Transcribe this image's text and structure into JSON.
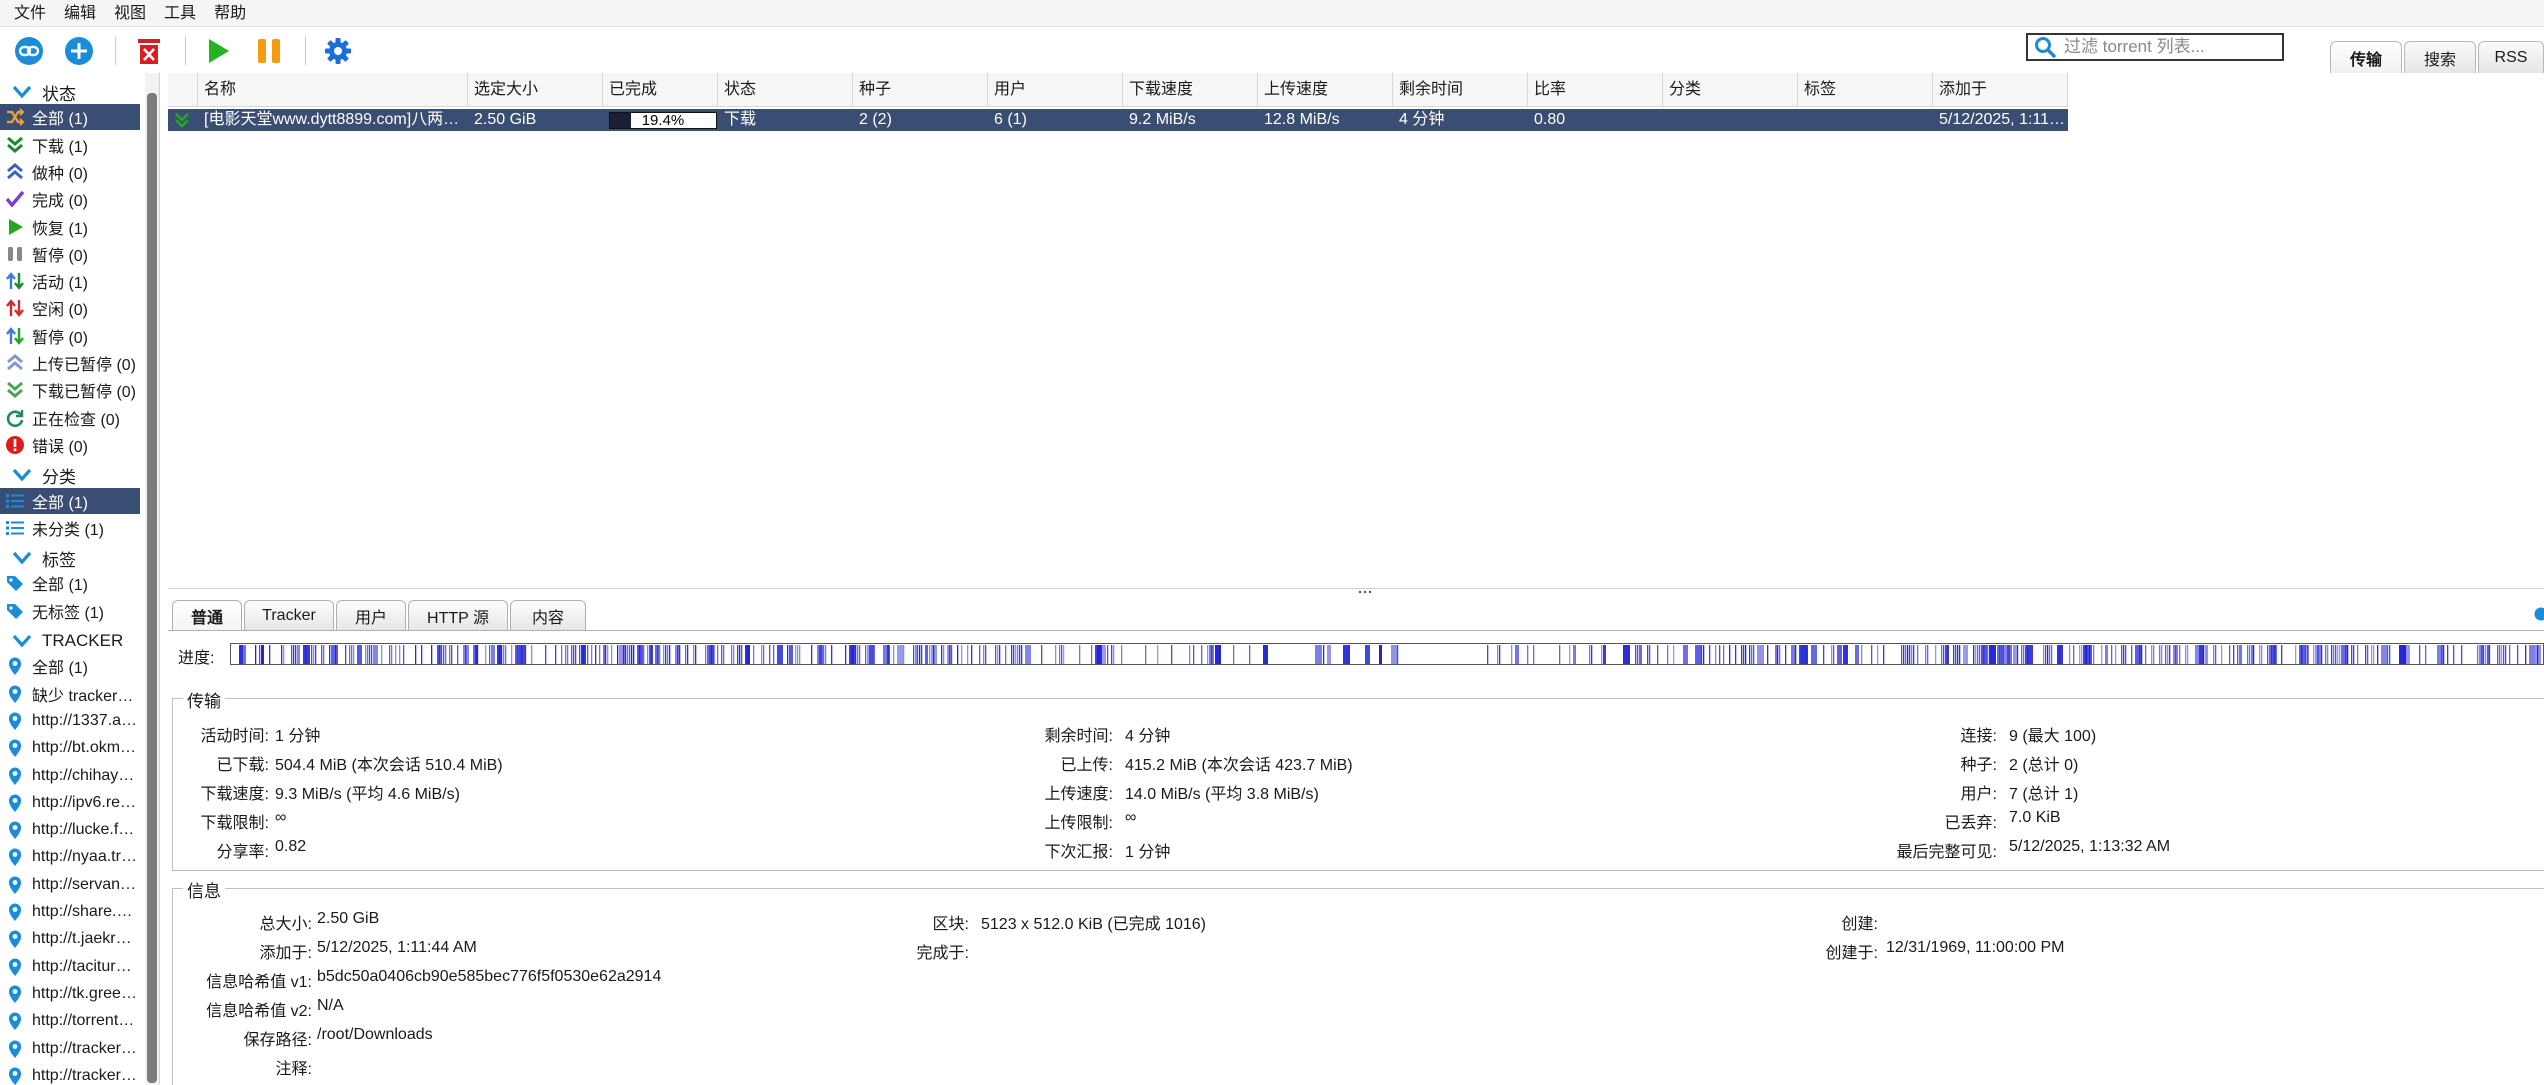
{
  "menu": [
    "文件",
    "编辑",
    "视图",
    "工具",
    "帮助"
  ],
  "toolbar": {
    "filter_placeholder": "过滤 torrent 列表...",
    "right_tabs": [
      "传输",
      "搜索",
      "RSS"
    ]
  },
  "sidebar": {
    "status_header": "状态",
    "status_items": [
      {
        "label": "全部 (1)",
        "icon": "shuffle-icon",
        "color": "#e8a33a"
      },
      {
        "label": "下载 (1)",
        "icon": "double-chevron-down-icon",
        "color": "#1e8a2a"
      },
      {
        "label": "做种 (0)",
        "icon": "double-chevron-up-icon",
        "color": "#3b63c4"
      },
      {
        "label": "完成 (0)",
        "icon": "checkmark-icon",
        "color": "#7a3ec8"
      },
      {
        "label": "恢复 (1)",
        "icon": "play-icon",
        "color": "#22a822"
      },
      {
        "label": "暂停 (0)",
        "icon": "pause-icon",
        "color": "#888888"
      },
      {
        "label": "活动 (1)",
        "icon": "up-down-arrows-icon",
        "color": "#1e8a2a"
      },
      {
        "label": "空闲 (0)",
        "icon": "up-down-arrows-red-icon",
        "color": "#d22a2a"
      },
      {
        "label": "暂停 (0)",
        "icon": "up-down-arrows-paused-icon",
        "color": "#3b7ad6"
      },
      {
        "label": "上传已暂停 (0)",
        "icon": "chevron-up-paused-icon",
        "color": "#7f9ad8"
      },
      {
        "label": "下载已暂停 (0)",
        "icon": "chevron-down-paused-icon",
        "color": "#4aa35a"
      },
      {
        "label": "正在检查 (0)",
        "icon": "refresh-icon",
        "color": "#1f8a6a"
      },
      {
        "label": "错误 (0)",
        "icon": "error-icon",
        "color": "#e01b1b"
      }
    ],
    "category_header": "分类",
    "category_items": [
      {
        "label": "全部 (1)",
        "icon": "list-icon"
      },
      {
        "label": "未分类 (1)",
        "icon": "list-icon"
      }
    ],
    "tag_header": "标签",
    "tag_items": [
      {
        "label": "全部 (1)",
        "icon": "tag-icon"
      },
      {
        "label": "无标签 (1)",
        "icon": "tag-icon"
      }
    ],
    "tracker_header": "TRACKER",
    "tracker_items": [
      "全部 (1)",
      "缺少 tracker…",
      "http://1337.a…",
      "http://bt.okm…",
      "http://chihay…",
      "http://ipv6.re…",
      "http://lucke.f…",
      "http://nyaa.tr…",
      "http://servan…",
      "http://share.…",
      "http://t.jaekr…",
      "http://tacitur…",
      "http://tk.gree…",
      "http://torrent…",
      "http://tracker…",
      "http://tracker…"
    ]
  },
  "table": {
    "columns": [
      "名称",
      "选定大小",
      "已完成",
      "状态",
      "种子",
      "用户",
      "下载速度",
      "上传速度",
      "剩余时间",
      "比率",
      "分类",
      "标签",
      "添加于"
    ],
    "row": {
      "name": "[电影天堂www.dytt8899.com]八两…",
      "size": "2.50 GiB",
      "progress_text": "19.4%",
      "progress": 0.194,
      "status": "下载",
      "seeds": "2 (2)",
      "peers": "6 (1)",
      "down_speed": "9.2 MiB/s",
      "up_speed": "12.8 MiB/s",
      "eta": "4 分钟",
      "ratio": "0.80",
      "category": "",
      "tags": "",
      "added": "5/12/2025, 1:11…"
    }
  },
  "details": {
    "tabs": [
      "普通",
      "Tracker",
      "用户",
      "HTTP 源",
      "内容"
    ],
    "progress_label": "进度:",
    "transfer_title": "传输",
    "transfer": {
      "col1": [
        {
          "label": "活动时间:",
          "value": "1 分钟"
        },
        {
          "label": "已下载:",
          "value": "504.4 MiB (本次会话 510.4 MiB)"
        },
        {
          "label": "下载速度:",
          "value": "9.3 MiB/s (平均 4.6 MiB/s)"
        },
        {
          "label": "下载限制:",
          "value": "∞"
        },
        {
          "label": "分享率:",
          "value": "0.82"
        }
      ],
      "col2": [
        {
          "label": "剩余时间:",
          "value": "4 分钟"
        },
        {
          "label": "已上传:",
          "value": "415.2 MiB (本次会话 423.7 MiB)"
        },
        {
          "label": "上传速度:",
          "value": "14.0 MiB/s (平均 3.8 MiB/s)"
        },
        {
          "label": "上传限制:",
          "value": "∞"
        },
        {
          "label": "下次汇报:",
          "value": "1 分钟"
        }
      ],
      "col3": [
        {
          "label": "连接:",
          "value": "9 (最大 100)"
        },
        {
          "label": "种子:",
          "value": "2 (总计 0)"
        },
        {
          "label": "用户:",
          "value": "7 (总计 1)"
        },
        {
          "label": "已丢弃:",
          "value": "7.0 KiB"
        },
        {
          "label": "最后完整可见:",
          "value": "5/12/2025, 1:13:32 AM"
        }
      ]
    },
    "info_title": "信息",
    "info": {
      "col1": [
        {
          "label": "总大小:",
          "value": "2.50 GiB"
        },
        {
          "label": "添加于:",
          "value": "5/12/2025, 1:11:44 AM"
        },
        {
          "label": "信息哈希值 v1:",
          "value": "b5dc50a0406cb90e585bec776f5f0530e62a2914"
        },
        {
          "label": "信息哈希值 v2:",
          "value": "N/A"
        },
        {
          "label": "保存路径:",
          "value": "/root/Downloads"
        },
        {
          "label": "注释:",
          "value": ""
        }
      ],
      "col2": [
        {
          "label": "区块:",
          "value": "5123 x 512.0 KiB (已完成 1016)"
        },
        {
          "label": "完成于:",
          "value": ""
        }
      ],
      "col3": [
        {
          "label": "创建:",
          "value": ""
        },
        {
          "label": "创建于:",
          "value": "12/31/1969, 11:00:00 PM"
        }
      ]
    }
  },
  "colors": {
    "selection": "#3a4d72",
    "accent_blue": "#1a8cd8",
    "piece_color": "#2323d8"
  }
}
